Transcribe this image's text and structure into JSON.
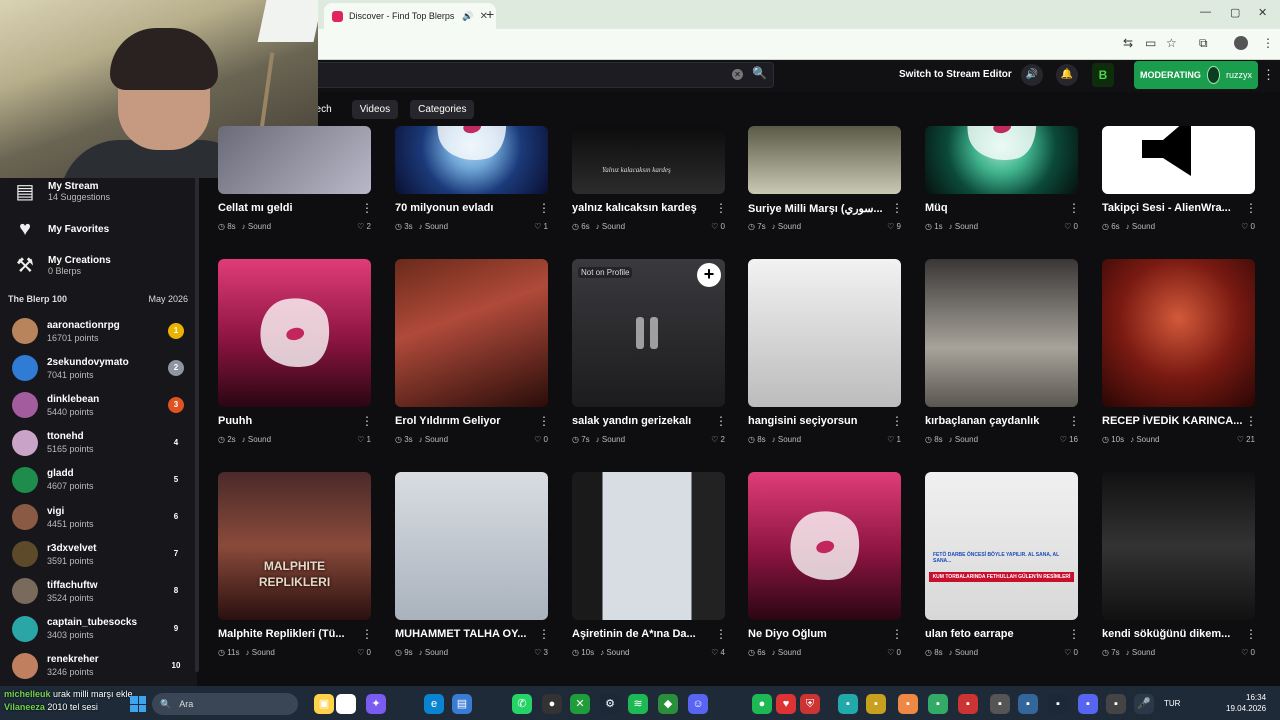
{
  "browser": {
    "tab_title": "Discover - Find Top Blerps",
    "tab_audio_icon": "speaker-icon",
    "new_tab_symbol": "+",
    "window_controls": [
      "—",
      "▢",
      "✕"
    ]
  },
  "header": {
    "switch_stream_editor": "Switch to Stream Editor",
    "moderating_label": "MODERATING",
    "username": "ruzzyx",
    "logo_text": "B"
  },
  "categories": {
    "items": [
      "eech",
      "Videos",
      "Categories"
    ]
  },
  "sidebar": {
    "my_stream": {
      "title": "My Stream",
      "sub": "14 Suggestions"
    },
    "my_favorites": {
      "title": "My Favorites"
    },
    "my_creations": {
      "title": "My Creations",
      "sub": "0 Blerps"
    },
    "blerp100": {
      "title": "The Blerp 100",
      "date": "May 2026"
    },
    "leaderboard": [
      {
        "name": "aaronactionrpg",
        "points": "16701 points",
        "rank": "1",
        "color": "#e8b400"
      },
      {
        "name": "2sekundovymato",
        "points": "7041 points",
        "rank": "2",
        "color": "#8f94a0"
      },
      {
        "name": "dinklebean",
        "points": "5440 points",
        "rank": "3",
        "color": "#e0521f"
      },
      {
        "name": "ttonehd",
        "points": "5165 points",
        "rank": "4",
        "color": ""
      },
      {
        "name": "gladd",
        "points": "4607 points",
        "rank": "5",
        "color": ""
      },
      {
        "name": "vigi",
        "points": "4451 points",
        "rank": "6",
        "color": ""
      },
      {
        "name": "r3dxvelvet",
        "points": "3591 points",
        "rank": "7",
        "color": ""
      },
      {
        "name": "tiffachuftw",
        "points": "3524 points",
        "rank": "8",
        "color": ""
      },
      {
        "name": "captain_tubesocks",
        "points": "3403 points",
        "rank": "9",
        "color": ""
      },
      {
        "name": "renekreher",
        "points": "3246 points",
        "rank": "10",
        "color": ""
      }
    ]
  },
  "grid": {
    "sound_label": "Sound",
    "not_on_profile": "Not on Profile",
    "row1": [
      {
        "title": "Cellat mı geldi",
        "dur": "8s",
        "likes": "2"
      },
      {
        "title": "70 milyonun evladı",
        "dur": "3s",
        "likes": "1"
      },
      {
        "title": "yalnız kalıcaksın kardeş",
        "dur": "6s",
        "likes": "0"
      },
      {
        "title": "Suriye Milli Marşı (سوري...",
        "dur": "7s",
        "likes": "9"
      },
      {
        "title": "Müq",
        "dur": "1s",
        "likes": "0"
      },
      {
        "title": "Takipçi Sesi - AlienWra...",
        "dur": "6s",
        "likes": "0"
      }
    ],
    "row2": [
      {
        "title": "Puuhh",
        "dur": "2s",
        "likes": "1"
      },
      {
        "title": "Erol Yıldırım Geliyor",
        "dur": "3s",
        "likes": "0"
      },
      {
        "title": "salak yandın gerizekalı",
        "dur": "7s",
        "likes": "2"
      },
      {
        "title": "hangisini seçiyorsun",
        "dur": "8s",
        "likes": "1"
      },
      {
        "title": "kırbaçlanan çaydanlık",
        "dur": "8s",
        "likes": "16"
      },
      {
        "title": "RECEP İVEDİK KARINCA...",
        "dur": "10s",
        "likes": "21"
      }
    ],
    "row3": [
      {
        "title": "Malphite Replikleri (Tü...",
        "dur": "11s",
        "likes": "0"
      },
      {
        "title": "MUHAMMET TALHA OY...",
        "dur": "9s",
        "likes": "3"
      },
      {
        "title": "Aşiretinin de A*ına Da...",
        "dur": "10s",
        "likes": "4"
      },
      {
        "title": "Ne Diyo Oğlum",
        "dur": "6s",
        "likes": "0"
      },
      {
        "title": "ulan feto earrape",
        "dur": "8s",
        "likes": "0"
      },
      {
        "title": "kendi söküğünü dikem...",
        "dur": "7s",
        "likes": "0"
      }
    ],
    "thumb_texts": {
      "yalniz": "Yalnız kalacaksın kardeş",
      "malphite": "MALPHITE REPLIKLERI",
      "feto_banner": "KUM TORBALARINDA FETHULLAH GÜLEN'İN RESİMLERİ",
      "feto_caption": "FETÖ DARBE ÖNCESİ BÖYLE YAPILIR. AL SANA, AL SANA..."
    }
  },
  "taskbar": {
    "search_label": "Ara",
    "lang": "TUR",
    "time": "16:34",
    "date": "19.04.2026",
    "chat_line1_user": "michelleuk",
    "chat_line1_text": "urak milli marşı ekle",
    "chat_line2_user": "Vilaneeza",
    "chat_line2_text": "2010 tel sesi"
  },
  "colors": {
    "accent_green": "#1a9e4d",
    "background": "#0e0e10",
    "sidebar": "#17171b"
  }
}
